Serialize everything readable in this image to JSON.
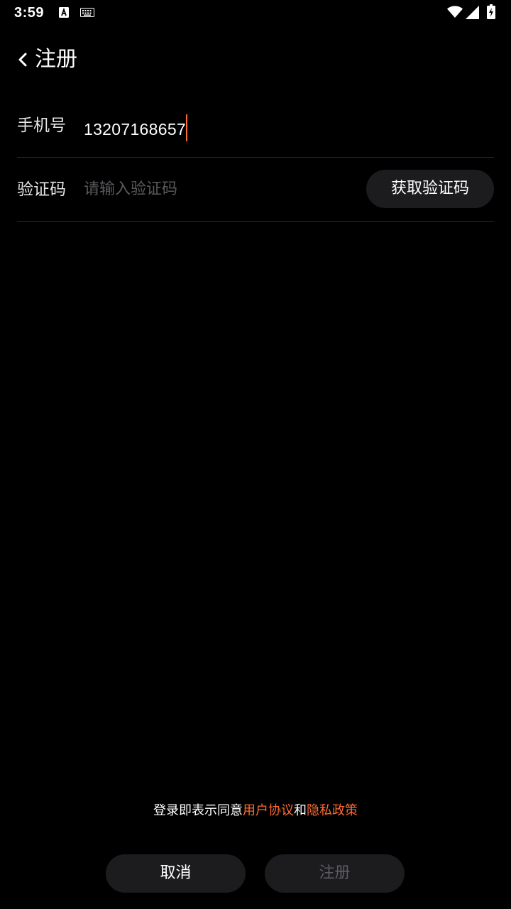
{
  "status_bar": {
    "time": "3:59",
    "icons": [
      "a-icon",
      "keyboard-icon",
      "wifi-icon",
      "signal-icon",
      "battery-charging-icon"
    ]
  },
  "header": {
    "back_icon": "chevron-left-icon",
    "title": "注册"
  },
  "form": {
    "phone": {
      "label": "手机号",
      "value": "13207168657"
    },
    "code": {
      "label": "验证码",
      "placeholder": "请输入验证码",
      "get_code_label": "获取验证码"
    }
  },
  "agreement": {
    "prefix": "登录即表示同意",
    "user_agreement": "用户协议",
    "conjunction": "和",
    "privacy_policy": "隐私政策"
  },
  "buttons": {
    "cancel_label": "取消",
    "register_label": "注册"
  },
  "colors": {
    "background": "#000000",
    "accent": "#ff6b35",
    "button_bg": "#1c1c1f",
    "divider": "#2a2a2d",
    "disabled_text": "#5e5e62"
  }
}
